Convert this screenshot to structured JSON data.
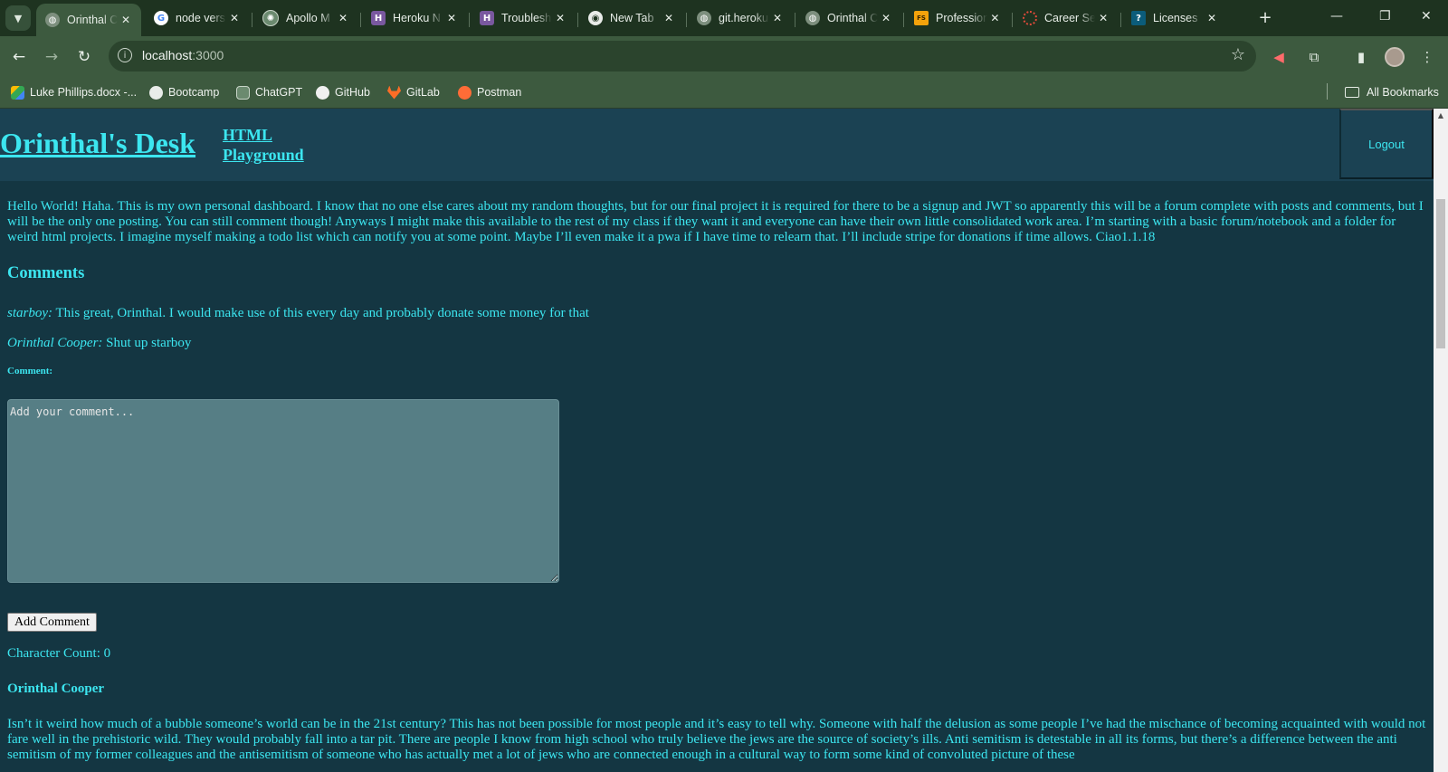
{
  "browser": {
    "tabs": [
      {
        "title": "Orinthal C",
        "favicon": "globe-icon",
        "active": true
      },
      {
        "title": "node vers",
        "favicon": "google-icon"
      },
      {
        "title": "Apollo M",
        "favicon": "openai-icon"
      },
      {
        "title": "Heroku N",
        "favicon": "heroku-icon"
      },
      {
        "title": "Troublesh",
        "favicon": "heroku-icon"
      },
      {
        "title": "New Tab",
        "favicon": "chrome-icon"
      },
      {
        "title": "git.heroku",
        "favicon": "globe-icon"
      },
      {
        "title": "Orinthal C",
        "favicon": "globe-icon"
      },
      {
        "title": "Profession",
        "favicon": "fs-icon"
      },
      {
        "title": "Career Se",
        "favicon": "spinner-icon"
      },
      {
        "title": "Licenses",
        "favicon": "help-icon"
      }
    ],
    "url_host": "localhost",
    "url_port": ":3000",
    "bookmarks": [
      {
        "label": "Luke Phillips.docx -...",
        "icon": "google-drive-icon"
      },
      {
        "label": "Bootcamp",
        "icon": "globe-icon"
      },
      {
        "label": "ChatGPT",
        "icon": "openai-icon"
      },
      {
        "label": "GitHub",
        "icon": "github-icon"
      },
      {
        "label": "GitLab",
        "icon": "gitlab-icon"
      },
      {
        "label": "Postman",
        "icon": "postman-icon"
      }
    ],
    "all_bookmarks": "All Bookmarks"
  },
  "site": {
    "title": "Orinthal's Desk",
    "nav_link": "HTML Playground",
    "logout": "Logout"
  },
  "post": {
    "body": "Hello World! Haha. This is my own personal dashboard. I know that no one else cares about my random thoughts, but for our final project it is required for there to be a signup and JWT so apparently this will be a forum complete with posts and comments, but I will be the only one posting. You can still comment though! Anyways I might make this available to the rest of my class if they want it and everyone can have their own little consolidated work area. I’m starting with a basic forum/notebook and a folder for weird html projects. I imagine myself making a todo list which can notify you at some point. Maybe I’ll even make it a pwa if I have time to relearn that. I’ll include stripe for donations if time allows. Ciao1.1.18",
    "comments_heading": "Comments",
    "comments": [
      {
        "author": "starboy:",
        "text": "This great, Orinthal. I would make use of this every day and probably donate some money for that"
      },
      {
        "author": "Orinthal Cooper:",
        "text": "Shut up starboy"
      }
    ],
    "comment_label": "Comment:",
    "comment_placeholder": "Add your comment...",
    "add_comment_button": "Add Comment",
    "character_count_label": "Character Count: 0"
  },
  "post2": {
    "author": "Orinthal Cooper",
    "body": "Isn’t it weird how much of a bubble someone’s world can be in the 21st century? This has not been possible for most people and it’s easy to tell why. Someone with half the delusion as some people I’ve had the mischance of becoming acquainted with would not fare well in the prehistoric wild. They would probably fall into a tar pit. There are people I know from high school who truly believe the jews are the source of society’s ills. Anti semitism is detestable in all its forms, but there’s a difference between the anti semitism of my former colleagues and the antisemitism of someone who has actually met a lot of jews who are connected enough in a cultural way to form some kind of convoluted picture of these"
  },
  "colors": {
    "page_bg": "#143642",
    "header_bg": "#1b4253",
    "accent_text": "#3ce6f0",
    "textarea_bg": "#567e85",
    "chrome_bg": "#3d5a3f"
  }
}
